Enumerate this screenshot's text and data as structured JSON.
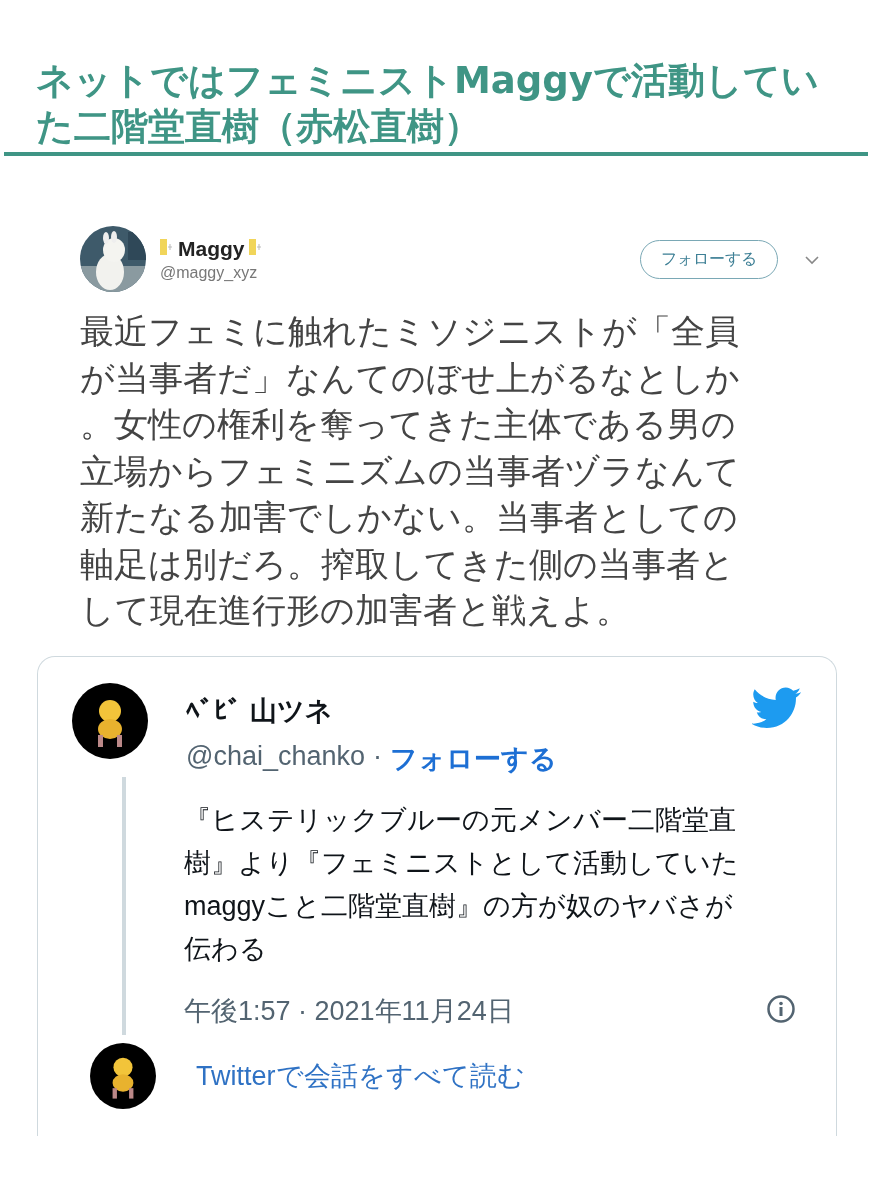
{
  "heading": "ネットではフェミニストMaggyで活動していた二階堂直樹（赤松直樹）",
  "screenshot_tweet": {
    "name": "Maggy",
    "handle": "@maggy_xyz",
    "follow_button": "フォローする",
    "text": "最近フェミに触れたミソジニストが「全員が当事者だ」なんてのぼせ上がるなとしか。女性の権利を奪ってきた主体である男の立場からフェミニズムの当事者ヅラなんて新たなる加害でしかない。当事者としての軸足は別だろ。搾取してきた側の当事者として現在進行形の加害者と戦えよ。"
  },
  "embedded_tweet": {
    "name": "ﾍﾞﾋﾞ 山ツネ",
    "handle": "@chai_chanko",
    "separator": "·",
    "follow_link": "フォローする",
    "text": "『ヒステリックブルーの元メンバー二階堂直樹』より『フェミニストとして活動していたmaggyこと二階堂直樹』の方が奴のヤバさが伝わる",
    "timestamp": "午後1:57 · 2021年11月24日",
    "read_more": "Twitterで会話をすべて読む"
  }
}
